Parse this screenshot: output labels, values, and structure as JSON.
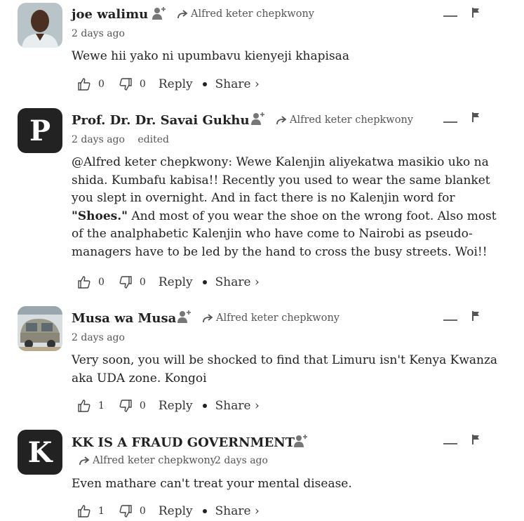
{
  "comments": [
    {
      "author": "joe walimu",
      "reply_to": "Alfred keter chepkwony",
      "time": "2 days ago",
      "edited": "",
      "text": "Wewe hii yako ni upumbavu kienyeji khapisaa",
      "upvotes": "0",
      "downvotes": "0"
    },
    {
      "author": "Prof. Dr. Dr. Savai Gukhu",
      "avatar_letter": "P",
      "reply_to": "Alfred keter chepkwony",
      "time": "2 days ago",
      "edited": "edited",
      "text_before": "@Alfred keter chepkwony: Wewe Kalenjin aliyekatwa masikio uko na shida. Kumbafu kabisa!! Recently you used to wear the same blanket you slept in overnight. And in fact there is no Kalenjin word for ",
      "text_bold": "\"Shoes.\"",
      "text_after": " And most of you wear the shoe on the wrong foot. Also most of the analphabetic Kalenjin who have come to Nairobi as pseudo-managers have to be led by the hand to cross the busy streets. Woi!!",
      "upvotes": "0",
      "downvotes": "0"
    },
    {
      "author": "Musa wa Musa",
      "reply_to": "Alfred keter chepkwony",
      "time": "2 days ago",
      "edited": "",
      "text": "Very soon, you will be shocked to find that Limuru isn't Kenya Kwanza aka UDA zone. Kongoi",
      "upvotes": "1",
      "downvotes": "0"
    },
    {
      "author": "KK IS A FRAUD GOVERNMENT",
      "avatar_letter": "K",
      "reply_to": "Alfred keter chepkwony",
      "time": "2 days ago",
      "edited": "",
      "text": "Even mathare can't treat your mental disease.",
      "upvotes": "1",
      "downvotes": "0"
    }
  ],
  "labels": {
    "reply": "Reply",
    "share": "Share ›"
  }
}
